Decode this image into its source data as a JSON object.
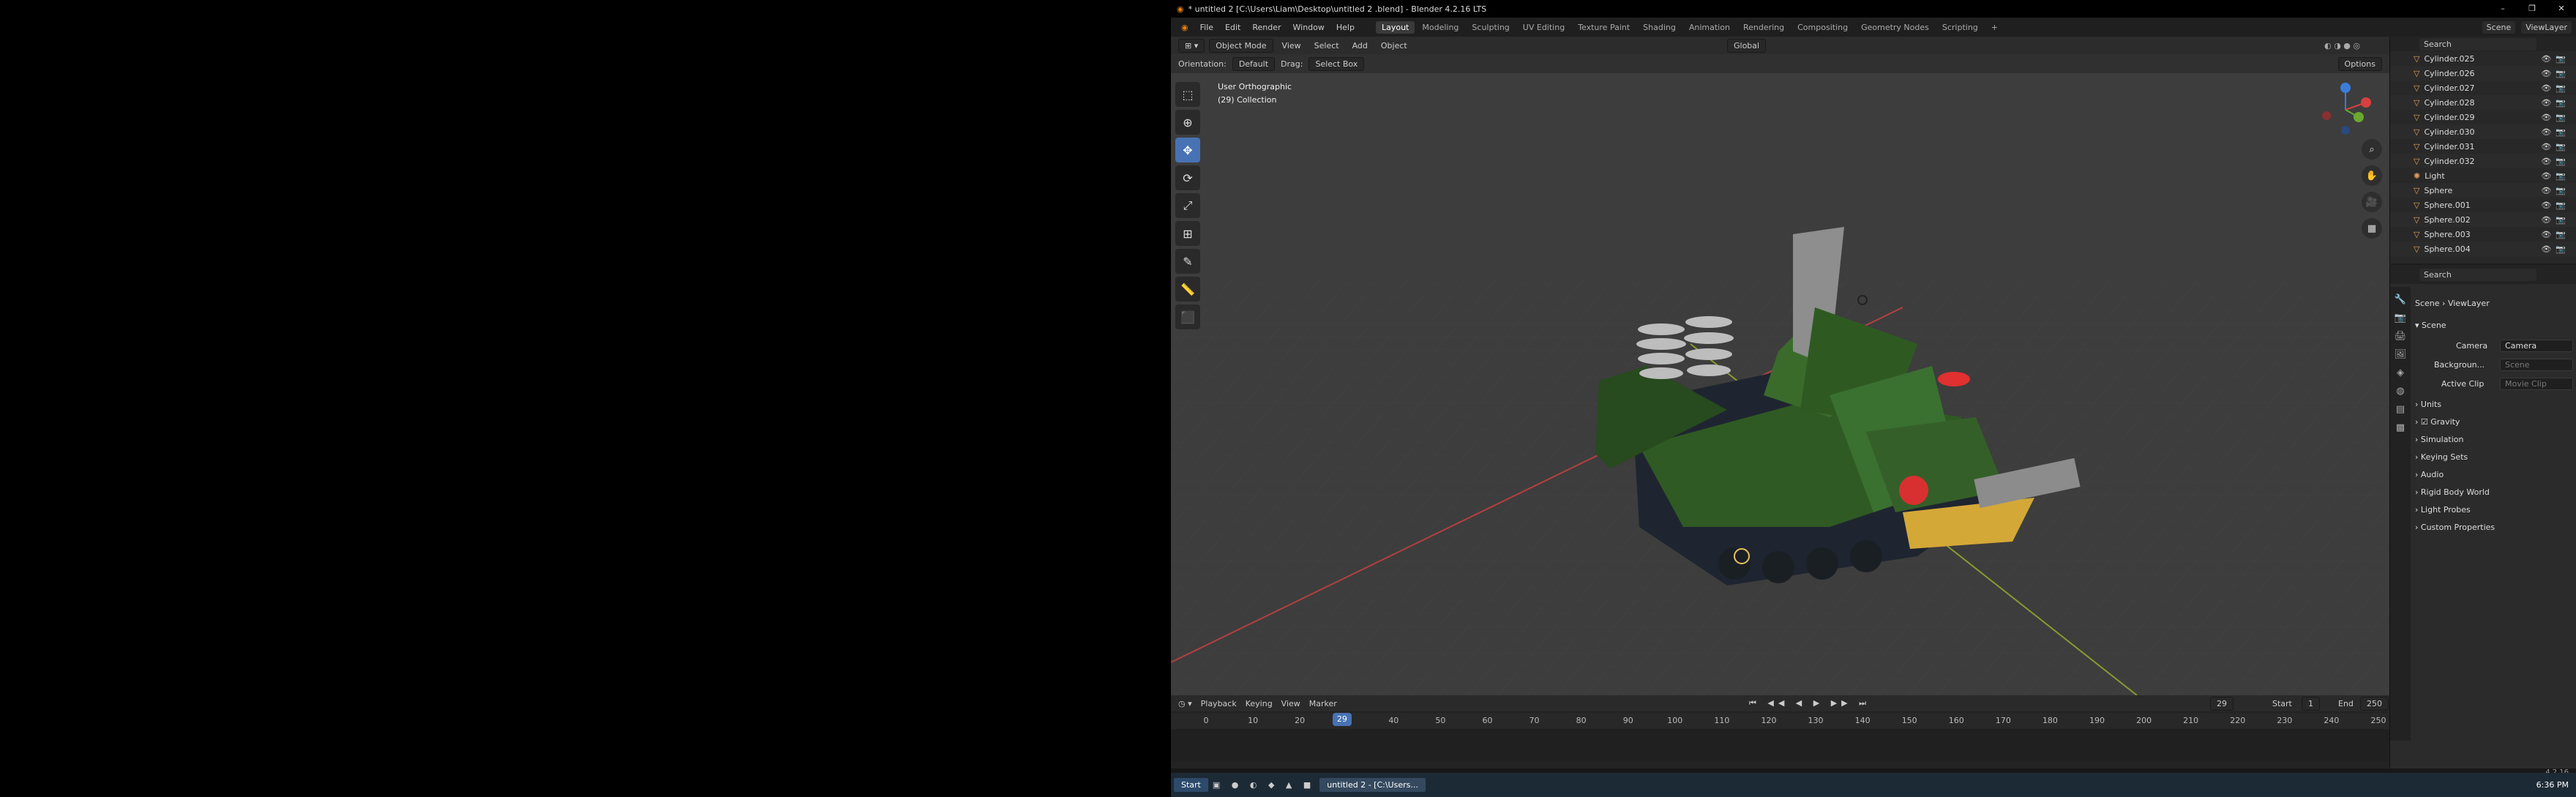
{
  "window": {
    "title": "* untitled 2 [C:\\Users\\Liam\\Desktop\\untitled 2 .blend] - Blender 4.2.16 LTS",
    "min": "–",
    "max": "❐",
    "close": "✕"
  },
  "menubar": {
    "menus": [
      "File",
      "Edit",
      "Render",
      "Window",
      "Help"
    ],
    "workspaces": [
      "Layout",
      "Modeling",
      "Sculpting",
      "UV Editing",
      "Texture Paint",
      "Shading",
      "Animation",
      "Rendering",
      "Compositing",
      "Geometry Nodes",
      "Scripting"
    ],
    "active_workspace": "Layout",
    "scene": "Scene",
    "view_layer": "ViewLayer"
  },
  "viewport": {
    "mode": "Object Mode",
    "menus": [
      "View",
      "Select",
      "Add",
      "Object"
    ],
    "transform": "Global",
    "orientation_label": "Orientation:",
    "orientation": "Default",
    "drag_label": "Drag:",
    "drag": "Select Box",
    "options": "Options",
    "view_name": "User Orthographic",
    "collection": "(29) Collection"
  },
  "timeline": {
    "menus": [
      "Playback",
      "Keying",
      "View",
      "Marker"
    ],
    "current_frame": "29",
    "start_label": "Start",
    "start": "1",
    "end_label": "End",
    "end": "250",
    "ticks": [
      "0",
      "10",
      "20",
      "30",
      "40",
      "50",
      "60",
      "70",
      "80",
      "90",
      "100",
      "110",
      "120",
      "130",
      "140",
      "150",
      "160",
      "170",
      "180",
      "190",
      "200",
      "210",
      "220",
      "230",
      "240",
      "250"
    ]
  },
  "outliner": {
    "search_placeholder": "Search",
    "items": [
      "Cylinder.025",
      "Cylinder.026",
      "Cylinder.027",
      "Cylinder.028",
      "Cylinder.029",
      "Cylinder.030",
      "Cylinder.031",
      "Cylinder.032",
      "Light",
      "Sphere",
      "Sphere.001",
      "Sphere.002",
      "Sphere.003",
      "Sphere.004"
    ]
  },
  "properties": {
    "search_placeholder": "Search",
    "breadcrumb": [
      "Scene",
      "ViewLayer"
    ],
    "section": "Scene",
    "camera_label": "Camera",
    "camera_value": "Camera",
    "background_label": "Backgroun...",
    "background_value": "Scene",
    "active_clip_label": "Active Clip",
    "active_clip_value": "Movie Clip",
    "panels": [
      "Units",
      "Gravity",
      "Simulation",
      "Keying Sets",
      "Audio",
      "Rigid Body World",
      "Light Probes",
      "Custom Properties"
    ]
  },
  "statusbar": {
    "version": "4.2.16"
  },
  "taskbar": {
    "start": "Start",
    "task": "untitled 2 - [C:\\Users...",
    "time": "6:36 PM"
  }
}
